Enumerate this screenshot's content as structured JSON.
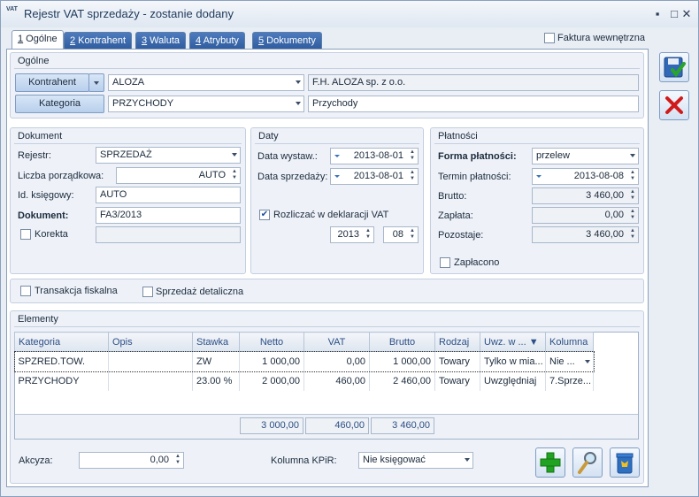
{
  "window": {
    "icon_text": "VAT",
    "title": "Rejestr VAT sprzedaży - zostanie dodany",
    "minimize": "▪",
    "maximize": "□",
    "close": "✕"
  },
  "tabs": [
    {
      "num": "1",
      "label": " Ogólne"
    },
    {
      "num": "2",
      "label": " Kontrahent"
    },
    {
      "num": "3",
      "label": " Waluta"
    },
    {
      "num": "4",
      "label": " Atrybuty"
    },
    {
      "num": "5",
      "label": " Dokumenty"
    }
  ],
  "faktura_wewnetrzna": {
    "label": "Faktura wewnętrzna",
    "checked": false
  },
  "ogolne": {
    "title": "Ogólne",
    "kontrahent_button": "Kontrahent",
    "kontrahent_code": "ALOZA",
    "kontrahent_name": "F.H. ALOZA sp. z o.o.",
    "kategoria_button": "Kategoria",
    "kategoria_code": "PRZYCHODY",
    "kategoria_name": "Przychody"
  },
  "dokument": {
    "title": "Dokument",
    "rejestr_label": "Rejestr:",
    "rejestr_value": "SPRZEDAŻ",
    "liczba_label": "Liczba porządkowa:",
    "liczba_value": "AUTO",
    "id_label": "Id. księgowy:",
    "id_value": "AUTO",
    "dokument_label": "Dokument:",
    "dokument_value": "FA3/2013",
    "korekta_label": "Korekta",
    "korekta_value": ""
  },
  "daty": {
    "title": "Daty",
    "wystaw_label": "Data wystaw.:",
    "wystaw_value": "2013-08-01",
    "sprzedazy_label": "Data sprzedaży:",
    "sprzedazy_value": "2013-08-01",
    "rozliczac_label": "Rozliczać w deklaracji VAT",
    "rozliczac_checked": true,
    "rok": "2013",
    "miesiac": "08"
  },
  "platnosci": {
    "title": "Płatności",
    "forma_label": "Forma płatności:",
    "forma_value": "przelew",
    "termin_label": "Termin płatności:",
    "termin_value": "2013-08-08",
    "brutto_label": "Brutto:",
    "brutto_value": "3 460,00",
    "zaplata_label": "Zapłata:",
    "zaplata_value": "0,00",
    "pozostaje_label": "Pozostaje:",
    "pozostaje_value": "3 460,00",
    "zaplacono_label": "Zapłacono"
  },
  "opcje": {
    "transakcja_label": "Transakcja fiskalna",
    "detaliczna_label": "Sprzedaż detaliczna"
  },
  "elementy": {
    "title": "Elementy",
    "columns": [
      "Kategoria",
      "Opis",
      "Stawka",
      "Netto",
      "VAT",
      "Brutto",
      "Rodzaj",
      "Uwz. w ... ▼",
      "Kolumna"
    ],
    "rows": [
      [
        "SPZRED.TOW.",
        "",
        "ZW",
        "1 000,00",
        "0,00",
        "1 000,00",
        "Towary",
        "Tylko w mia...",
        "Nie ..."
      ],
      [
        "PRZYCHODY",
        "",
        "23.00 %",
        "2 000,00",
        "460,00",
        "2 460,00",
        "Towary",
        "Uwzględniaj",
        "7.Sprze..."
      ]
    ],
    "sum_netto": "3 000,00",
    "sum_vat": "460,00",
    "sum_brutto": "3 460,00"
  },
  "akcyza": {
    "label": "Akcyza:",
    "value": "0,00"
  },
  "kolumna_kpir": {
    "label": "Kolumna KPiR:",
    "value": "Nie księgować"
  },
  "colors": {
    "accent": "#2f5d9f",
    "add": "#21a321",
    "cancel": "#d11b1b"
  }
}
